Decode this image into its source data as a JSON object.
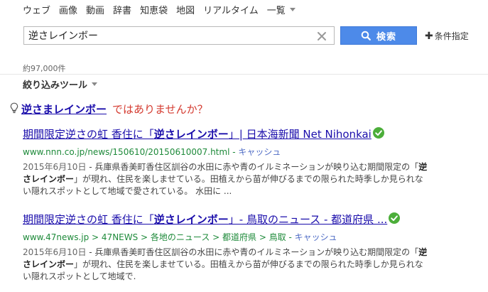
{
  "nav": {
    "items": [
      "ウェブ",
      "画像",
      "動画",
      "辞書",
      "知恵袋",
      "地図",
      "リアルタイム"
    ],
    "more_label": "一覧"
  },
  "search": {
    "query": "逆さレインボー",
    "button_label": "検索",
    "conditions_label": "条件指定"
  },
  "result_count": "約97,000件",
  "refine_label": "絞り込みツール",
  "suggestion": {
    "link": "逆さまレインボー",
    "text": "ではありませんか？"
  },
  "results": [
    {
      "title_pre": "期間限定逆さの虹 香住に「",
      "title_bold": "逆さレインボー",
      "title_post": "」| 日本海新聞 Net Nihonkai",
      "url": "www.nnn.co.jp/news/150610/20150610007.html",
      "url_sep": " - ",
      "cache_label": "キャッシュ",
      "date": "2015年6月10日",
      "snippet_pre": " - 兵庫県香美町香住区訓谷の水田に赤や青のイルミネーションが映り込む期間限定の「",
      "snippet_bold": "逆さレインボー",
      "snippet_post": "」が現れ、住民を楽しませている。田植えから苗が伸びるまでの限られた時季しか見られない隠れスポットとして地域で愛されている。 水田に ..."
    },
    {
      "title_pre": "期間限定逆さの虹 香住に「",
      "title_bold": "逆さレインボー",
      "title_post": "」- 鳥取のニュース - 都道府県 ...",
      "url": "www.47news.jp > 47NEWS > 各地のニュース > 都道府県 > 鳥取",
      "url_sep": " - ",
      "cache_label": "キャッシュ",
      "date": "2015年6月10日",
      "snippet_pre": " - 兵庫県香美町香住区訓谷の水田に赤や青のイルミネーションが映り込む期間限定の「",
      "snippet_bold": "逆さレインボー",
      "snippet_post": "」が現れ、住民を楽しませている。田植えから苗が伸びるまでの限られた時季しか見られない隠れスポットとして地域で."
    }
  ],
  "colors": {
    "accent": "#4d8ae9",
    "link": "#1a0dab",
    "url_green": "#1e8a3a",
    "suggest_red": "#d43a2f",
    "verified_green": "#4cae3a"
  }
}
